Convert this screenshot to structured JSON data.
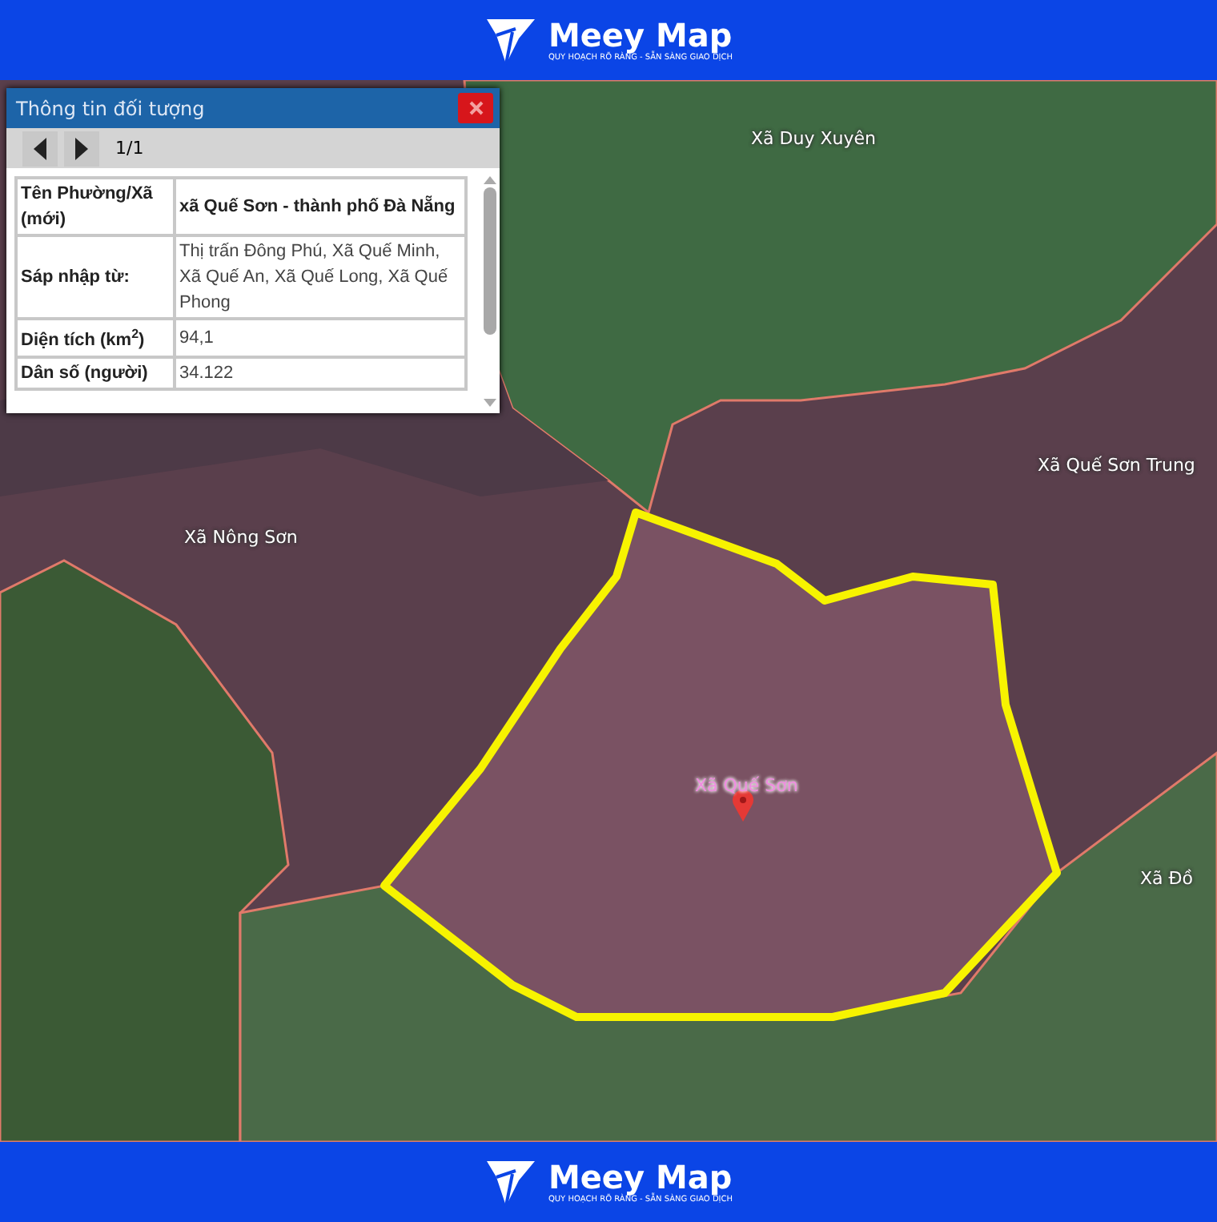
{
  "header": {
    "brand": "Meey Map",
    "tagline": "QUY HOẠCH RÕ RÀNG - SẴN SÀNG GIAO DỊCH"
  },
  "map": {
    "labels": [
      {
        "text": "Xã Duy Xuyên",
        "kind": "area"
      },
      {
        "text": "Xã Quế Sơn Trung",
        "kind": "area"
      },
      {
        "text": "Xã Nông Sơn",
        "kind": "area"
      },
      {
        "text": "Xã Quế Sơn",
        "kind": "selected"
      },
      {
        "text": "Xã Đồ",
        "kind": "area"
      }
    ]
  },
  "info_panel": {
    "title": "Thông tin đối tượng",
    "page_indicator": "1/1",
    "rows": [
      {
        "label": "Tên Phường/Xã (mới)",
        "value": "xã Quế Sơn - thành phố Đà Nẵng",
        "value_bold": true
      },
      {
        "label": "Sáp nhập từ:",
        "value": "Thị trấn Đông Phú, Xã Quế Minh, Xã Quế An, Xã Quế Long, Xã Quế Phong",
        "value_bold": false
      },
      {
        "label": "Diện tích (km$^{2}$)",
        "value": "94,1",
        "value_bold": false
      },
      {
        "label": "Dân số (người)",
        "value": "34.122",
        "value_bold": false
      }
    ]
  },
  "footer": {
    "brand": "Meey Map",
    "tagline": "QUY HOẠCH RÕ RÀNG - SẴN SÀNG GIAO DỊCH"
  }
}
